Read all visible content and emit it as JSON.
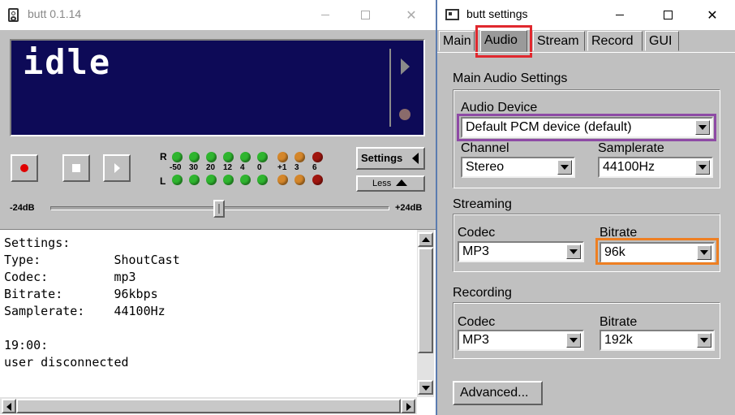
{
  "main_window": {
    "title": "butt 0.1.14",
    "display_text": "idle",
    "vu_top_label": "R",
    "vu_bottom_label": "L",
    "vu_scale": [
      "-50",
      "30",
      "20",
      "12",
      "4",
      "0",
      "+1",
      "3",
      "6"
    ],
    "settings_button": "Settings",
    "less_button": "Less",
    "gain_min": "-24dB",
    "gain_max": "+24dB",
    "log_lines": [
      "Settings:",
      "Type:          ShoutCast",
      "Codec:         mp3",
      "Bitrate:       96kbps",
      "Samplerate:    44100Hz",
      "",
      "19:00:",
      "user disconnected"
    ]
  },
  "settings_window": {
    "title": "butt settings",
    "tabs": [
      "Main",
      "Audio",
      "Stream",
      "Record",
      "GUI"
    ],
    "active_tab": "Audio",
    "main_audio": {
      "heading": "Main Audio Settings",
      "device_label": "Audio Device",
      "device_value": "Default PCM device (default)",
      "channel_label": "Channel",
      "channel_value": "Stereo",
      "samplerate_label": "Samplerate",
      "samplerate_value": "44100Hz"
    },
    "streaming": {
      "heading": "Streaming",
      "codec_label": "Codec",
      "codec_value": "MP3",
      "bitrate_label": "Bitrate",
      "bitrate_value": "96k"
    },
    "recording": {
      "heading": "Recording",
      "codec_label": "Codec",
      "codec_value": "MP3",
      "bitrate_label": "Bitrate",
      "bitrate_value": "192k"
    },
    "advanced_button": "Advanced..."
  },
  "colors": {
    "display_bg": "#0d0a57",
    "led_green": "#2fb52f",
    "led_orange": "#d4862a",
    "led_red": "#a0160f",
    "highlight_red": "#e0282e",
    "highlight_purple": "#8e4aa5",
    "highlight_orange": "#ee7f22"
  }
}
